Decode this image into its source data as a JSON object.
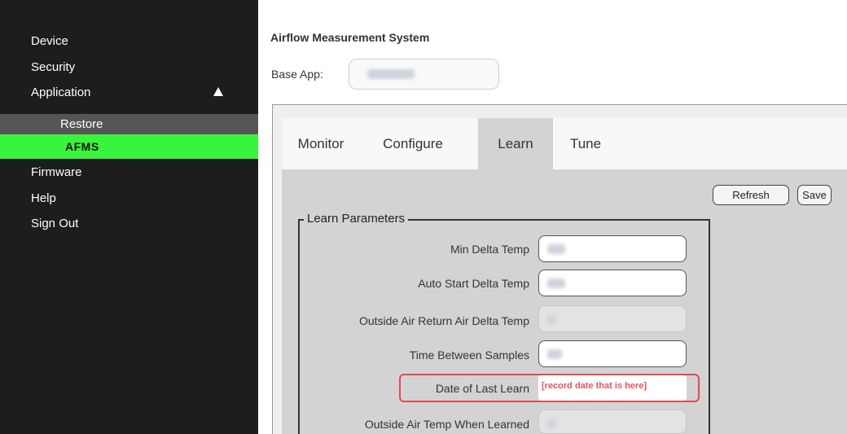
{
  "sidebar": {
    "items": [
      {
        "label": "Device"
      },
      {
        "label": "Security"
      },
      {
        "label": "Application"
      },
      {
        "label": "Restore"
      },
      {
        "label": "AFMS"
      },
      {
        "label": "Firmware"
      },
      {
        "label": "Help"
      },
      {
        "label": "Sign Out"
      }
    ],
    "application_expanded_icon": "triangle-up-icon"
  },
  "header": {
    "title": "Airflow Measurement System",
    "base_app_label": "Base App:"
  },
  "tabs": [
    {
      "label": "Monitor"
    },
    {
      "label": "Configure"
    },
    {
      "label": "Learn",
      "active": true
    },
    {
      "label": "Tune"
    }
  ],
  "toolbar": {
    "refresh_label": "Refresh",
    "save_label": "Save"
  },
  "learn_parameters": {
    "legend": "Learn Parameters",
    "fields": [
      {
        "label": "Min Delta Temp"
      },
      {
        "label": "Auto Start Delta Temp"
      },
      {
        "label": "Outside Air Return Air Delta Temp"
      },
      {
        "label": "Time Between Samples"
      },
      {
        "label": "Date of Last Learn",
        "value": "[record date that is here]"
      },
      {
        "label": "Outside Air Temp When Learned"
      }
    ]
  },
  "colors": {
    "sidebar_bg": "#1d1d1d",
    "active_nav": "#38f43b",
    "highlight": "#e14b53"
  }
}
